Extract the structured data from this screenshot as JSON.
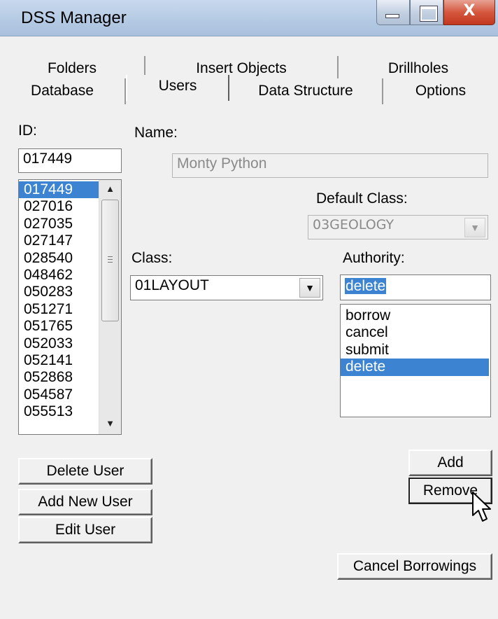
{
  "window": {
    "title": "DSS Manager",
    "close_glyph": "X"
  },
  "tabs": {
    "row1": [
      "Folders",
      "Insert Objects",
      "Drillholes"
    ],
    "row2": [
      "Database",
      "Users",
      "Data Structure",
      "Options"
    ],
    "active": "Users"
  },
  "form": {
    "id_label": "ID:",
    "id_value": "017449",
    "name_label": "Name:",
    "name_value": "Monty Python",
    "default_class_label": "Default Class:",
    "default_class_value": "03GEOLOGY",
    "class_label": "Class:",
    "class_value": "01LAYOUT",
    "authority_label": "Authority:",
    "authority_value": "delete"
  },
  "user_ids": [
    "017449",
    "027016",
    "027035",
    "027147",
    "028540",
    "048462",
    "050283",
    "051271",
    "051765",
    "052033",
    "052141",
    "052868",
    "054587",
    "055513"
  ],
  "user_ids_selected": "017449",
  "authorities": [
    "borrow",
    "cancel",
    "submit",
    "delete"
  ],
  "authorities_selected": "delete",
  "buttons": {
    "delete_user": "Delete User",
    "add_new_user": "Add New User",
    "edit_user": "Edit User",
    "add": "Add",
    "remove": "Remove",
    "cancel_borrowings": "Cancel Borrowings"
  },
  "icons": {
    "minimize": "minimize-icon",
    "maximize": "maximize-icon",
    "close": "close-icon",
    "scroll_up": "up-arrow-icon",
    "scroll_down": "down-arrow-icon",
    "dropdown": "chevron-down-icon",
    "cursor": "mouse-pointer-icon"
  }
}
